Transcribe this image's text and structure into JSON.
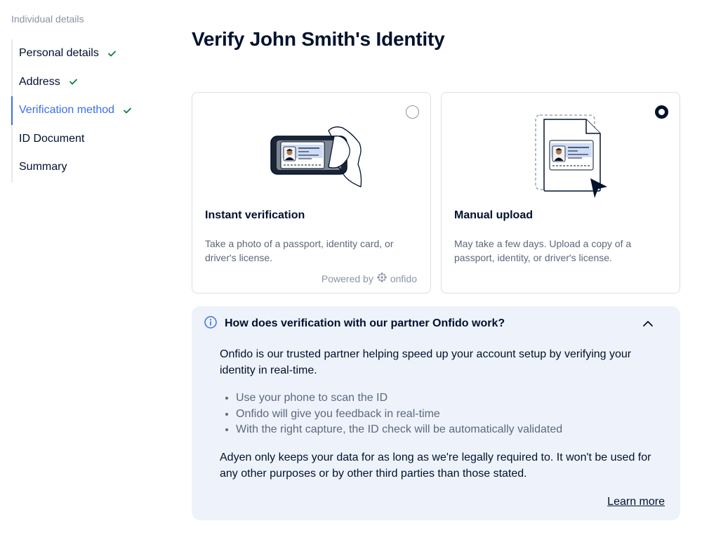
{
  "sidebar": {
    "title": "Individual details",
    "steps": [
      {
        "label": "Personal details",
        "completed": true
      },
      {
        "label": "Address",
        "completed": true
      },
      {
        "label": "Verification method",
        "completed": true,
        "active": true
      },
      {
        "label": "ID Document",
        "completed": false
      },
      {
        "label": "Summary",
        "completed": false
      }
    ]
  },
  "main": {
    "title": "Verify John Smith's Identity",
    "options": [
      {
        "title": "Instant verification",
        "description": "Take a photo of a passport, identity card, or driver's license.",
        "powered_by": "Powered by",
        "provider": "onfido",
        "selected": false
      },
      {
        "title": "Manual upload",
        "description": "May take a few days. Upload a copy of a passport, identity, or driver's license.",
        "selected": true
      }
    ],
    "info": {
      "heading": "How does verification with our partner Onfido work?",
      "intro": "Onfido is our trusted partner helping speed up your account setup by verifying your identity in real-time.",
      "bullets": [
        "Use your phone to scan the ID",
        "Onfido will give you feedback in real-time",
        "With the right capture, the ID check will be automatically validated"
      ],
      "retention": "Adyen only keeps your data for as long as we're legally required to. It won't be used for any other purposes or by other third parties than those stated.",
      "learn_more": "Learn more",
      "expanded": true
    }
  },
  "colors": {
    "accent": "#3a6ee8",
    "check": "#0a7d3e",
    "text": "#00112c",
    "muted": "#5c687c",
    "info_bg": "#eef3fb"
  }
}
